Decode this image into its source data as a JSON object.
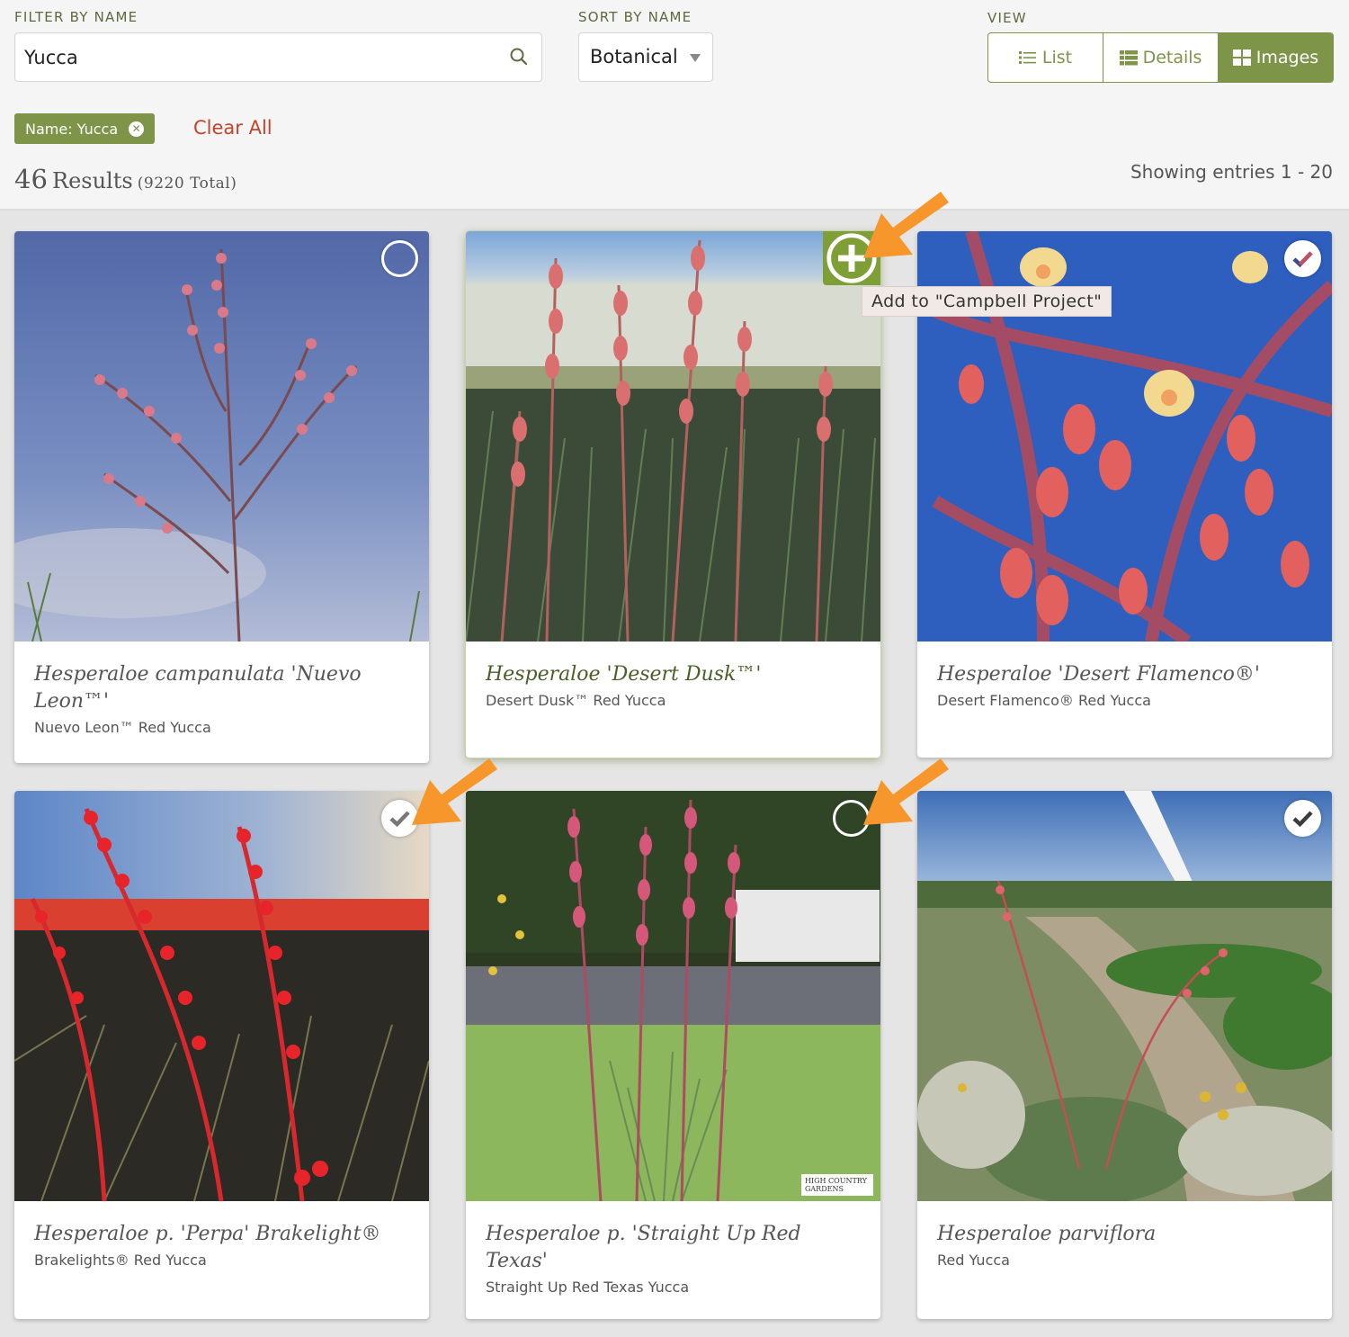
{
  "filter": {
    "label": "FILTER BY NAME",
    "value": "Yucca",
    "icon": "search-icon"
  },
  "sort": {
    "label": "SORT BY NAME",
    "selected": "Botanical"
  },
  "view": {
    "label": "VIEW",
    "options": [
      {
        "label": "List",
        "icon": "list-icon",
        "active": false
      },
      {
        "label": "Details",
        "icon": "details-icon",
        "active": false
      },
      {
        "label": "Images",
        "icon": "grid-icon",
        "active": true
      }
    ]
  },
  "active_filters": [
    {
      "label": "Name: Yucca",
      "icon": "remove-icon"
    }
  ],
  "clear_all_label": "Clear All",
  "results": {
    "count": "46",
    "word": "Results",
    "total": "(9220 Total)",
    "showing": "Showing entries 1 - 20"
  },
  "tooltip": "Add to \"Campbell Project\"",
  "watermark": "HIGH COUNTRY GARDENS",
  "colors": {
    "accent": "#7e9449",
    "add_button": "#7e9f35",
    "clear_all": "#c8422b",
    "annotation_arrow": "#f7962a"
  },
  "plants": [
    {
      "botanical": "Hesperaloe campanulata 'Nuevo Leon™'",
      "common": "Nuevo Leon™ Red Yucca",
      "selection": "unselected"
    },
    {
      "botanical": "Hesperaloe 'Desert Dusk™'",
      "common": "Desert Dusk™ Red Yucca",
      "selection": "add"
    },
    {
      "botanical": "Hesperaloe 'Desert Flamenco®'",
      "common": "Desert Flamenco® Red Yucca",
      "selection": "selected"
    },
    {
      "botanical": "Hesperaloe p. 'Perpa' Brakelight®",
      "common": "Brakelights® Red Yucca",
      "selection": "selected"
    },
    {
      "botanical": "Hesperaloe p. 'Straight Up Red Texas'",
      "common": "Straight Up Red Texas Yucca",
      "selection": "unselected"
    },
    {
      "botanical": "Hesperaloe parviflora",
      "common": "Red Yucca",
      "selection": "selected"
    }
  ]
}
